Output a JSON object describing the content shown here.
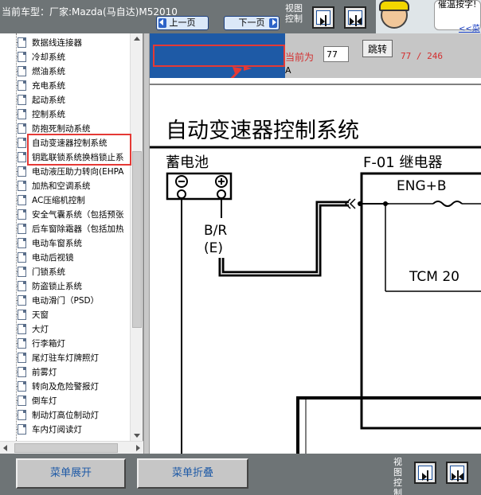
{
  "header": {
    "car_label": "当前车型：厂家:Mazda(马自达)M52010",
    "view_control_label": "视图控制",
    "mascot_bubble": "催温按字!",
    "mascot_link": "<<菜"
  },
  "sidebar": {
    "items": [
      {
        "label": "数据线连接器"
      },
      {
        "label": "冷却系统"
      },
      {
        "label": "燃油系统"
      },
      {
        "label": "充电系统"
      },
      {
        "label": "起动系统"
      },
      {
        "label": "控制系统"
      },
      {
        "label": "防抱死制动系统"
      },
      {
        "label": "自动变速器控制系统"
      },
      {
        "label": "钥匙联锁系统换档锁止系"
      },
      {
        "label": "电动液压助力转向(EHPA"
      },
      {
        "label": "加热和空调系统"
      },
      {
        "label": "AC压缩机控制"
      },
      {
        "label": "安全气囊系统（包括预张"
      },
      {
        "label": "后车窗除霜器（包括加热"
      },
      {
        "label": "电动车窗系统"
      },
      {
        "label": "电动后视镜"
      },
      {
        "label": "门锁系统"
      },
      {
        "label": "防盗锁止系统"
      },
      {
        "label": "电动滑门（PSD）"
      },
      {
        "label": "天窗"
      },
      {
        "label": "大灯"
      },
      {
        "label": "行李箱灯"
      },
      {
        "label": "尾灯驻车灯牌照灯"
      },
      {
        "label": "前雾灯"
      },
      {
        "label": "转向及危险警报灯"
      },
      {
        "label": "倒车灯"
      },
      {
        "label": "制动灯高位制动灯"
      },
      {
        "label": "车内灯阅读灯"
      }
    ]
  },
  "nav": {
    "prev_label": "上一页",
    "next_label": "下一页",
    "current_label": "当前为",
    "page_value": "77",
    "jump_label": "跳转",
    "page_count": "77 / 246",
    "stray_text": "A"
  },
  "diagram": {
    "title": "自动变速器控制系统",
    "battery": "蓄电池",
    "fuse_box": "F-01 继电器",
    "eng_fuse": "ENG+B",
    "wire_color": "B/R",
    "wire_code": "(E)",
    "tcm": "TCM 20"
  },
  "footer": {
    "expand_label": "菜单展开",
    "collapse_label": "菜单折叠",
    "view_control_label": "视图控制"
  },
  "colors": {
    "accent_blue": "#1e5aa6",
    "highlight_red": "#e53935",
    "toolbar_gray": "#6e7476"
  }
}
